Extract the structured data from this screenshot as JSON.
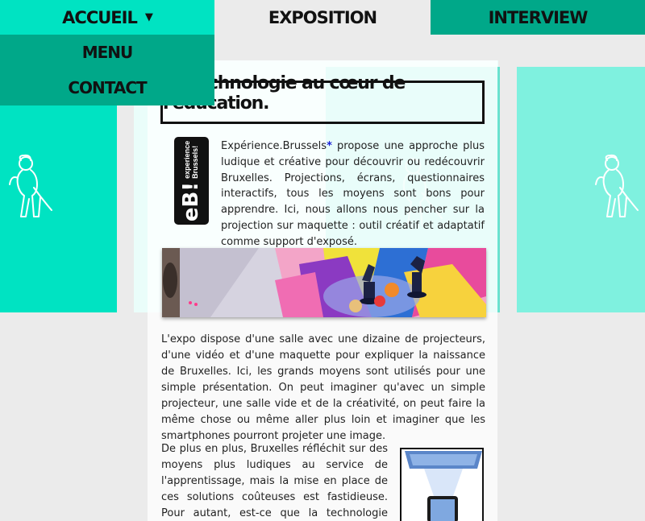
{
  "nav": {
    "tabs": [
      {
        "label": "ACCUEIL"
      },
      {
        "label": "EXPOSITION"
      },
      {
        "label": "INTERVIEW"
      }
    ],
    "dropdown": [
      {
        "label": "MENU"
      },
      {
        "label": "CONTACT"
      }
    ]
  },
  "article": {
    "title": "La technologie au cœur de l'éducation.",
    "logo": {
      "mark": "eB!",
      "line1": "experience",
      "line2": "Brussels!"
    },
    "intro_link": "Expérience.Brussels",
    "intro_star": "*",
    "intro_rest": " propose une approche plus ludique et créative pour découvrir ou redécouvrir Bruxelles. Projections, écrans, questionnaires interactifs, tous les moyens sont bons pour apprendre. Ici, nous allons nous pencher sur la projection sur maquette : outil créatif et adaptatif comme support d'exposé.",
    "para1": "L'expo dispose d'une salle avec une dizaine de projecteurs, d'une vidéo et d'une maquette pour expliquer la naissance de Bruxelles. Ici, les grands moyens sont utilisés pour une simple présentation. On peut imaginer qu'avec un simple projecteur, une salle vide et de la créativité, on peut faire la même chose ou même aller plus loin et imaginer que les smartphones pourront projeter une image.",
    "para2": "De plus en plus, Bruxelles réfléchit sur des moyens plus ludiques au service de l'apprentissage, mais la mise en place de ces solutions coûteuses est fastidieuse. Pour autant, est-ce que la technologie peut devenir un outil"
  },
  "colors": {
    "accent": "#00e3c2",
    "accent_dark": "#00a889",
    "accent_light": "#7ff1df"
  }
}
